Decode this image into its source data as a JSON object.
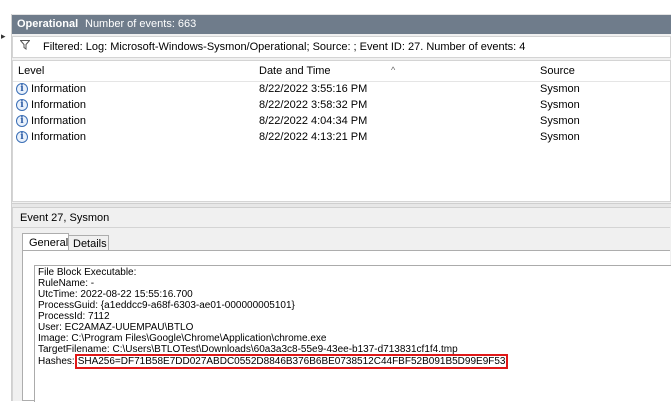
{
  "panel": {
    "title": "Operational",
    "event_count": "Number of events: 663"
  },
  "filter": {
    "icon": "funnel-icon",
    "text": "Filtered: Log: Microsoft-Windows-Sysmon/Operational; Source: ; Event ID: 27. Number of events: 4"
  },
  "grid": {
    "headers": {
      "level": "Level",
      "date": "Date and Time",
      "source": "Source"
    },
    "rows": [
      {
        "level": "Information",
        "date": "8/22/2022 3:55:16 PM",
        "source": "Sysmon"
      },
      {
        "level": "Information",
        "date": "8/22/2022 3:58:32 PM",
        "source": "Sysmon"
      },
      {
        "level": "Information",
        "date": "8/22/2022 4:04:34 PM",
        "source": "Sysmon"
      },
      {
        "level": "Information",
        "date": "8/22/2022 4:13:21 PM",
        "source": "Sysmon"
      }
    ]
  },
  "detail": {
    "title": "Event 27, Sysmon",
    "tabs": {
      "general": "General",
      "details": "Details"
    },
    "lines": [
      "File Block Executable:",
      "RuleName: -",
      "UtcTime: 2022-08-22 15:55:16.700",
      "ProcessGuid: {a1eddcc9-a68f-6303-ae01-000000005101}",
      "ProcessId: 7112",
      "User: EC2AMAZ-UUEMPAU\\BTLO",
      "Image: C:\\Program Files\\Google\\Chrome\\Application\\chrome.exe",
      "TargetFilename: C:\\Users\\BTLOTest\\Downloads\\60a3a3c8-55e9-43ee-b137-d713831cf1f4.tmp"
    ],
    "hashes_label": "Hashes:",
    "hashes_value": "SHA256=DF71B58E7DD027ABDC0552D8846B376B6BE0738512C44FBF52B091B5D99E9F53"
  },
  "colors": {
    "titlebar": "#6f7c8b",
    "highlight": "#e01818",
    "info": "#3b6fb6"
  }
}
